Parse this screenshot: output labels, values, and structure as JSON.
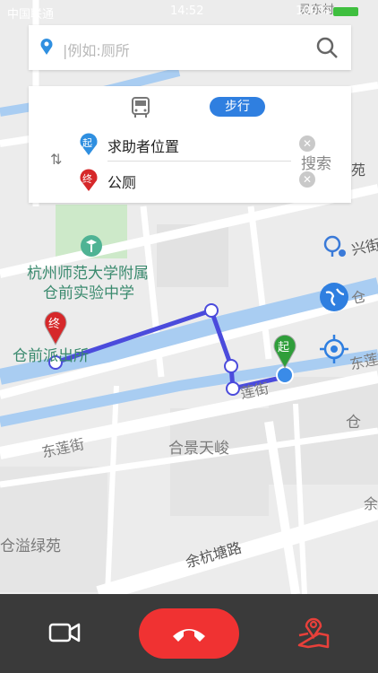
{
  "status_bar": {
    "carrier": "中国联通",
    "time": "14:52",
    "battery": "100%"
  },
  "search": {
    "placeholder": "|例如:厕所"
  },
  "route_panel": {
    "tabs": [
      "步行"
    ],
    "active_tab": "步行",
    "start_badge": "起",
    "end_badge": "终",
    "start": "求助者位置",
    "end": "公厕",
    "search_button": "搜索"
  },
  "map": {
    "labels": {
      "school_line1": "杭州师范大学附属",
      "school_line2": "仓前实验中学",
      "police": "仓前派出所",
      "street_donglian_1": "东莲街",
      "street_donglian_2": "莲街",
      "street_donglian_3": "东莲街",
      "community": "合景天峻",
      "yuhang_road": "余杭塘路",
      "cangyi": "仓溢绿苑",
      "cang_right": "仓",
      "cang_right2": "仓",
      "xingjie": "兴街",
      "yu_right": "余",
      "top_village": "灵东村",
      "yuan_fragment": "苑"
    },
    "markers": {
      "start": "起",
      "end": "终"
    },
    "colors": {
      "route": "#4b4bdc",
      "water": "#a9cdf2",
      "road": "#ffffff",
      "green": "#cde9c9"
    }
  },
  "bottom_bar": {
    "video_icon": "video-icon",
    "hangup_icon": "phone-hangup-icon",
    "location_icon": "map-location-icon"
  }
}
